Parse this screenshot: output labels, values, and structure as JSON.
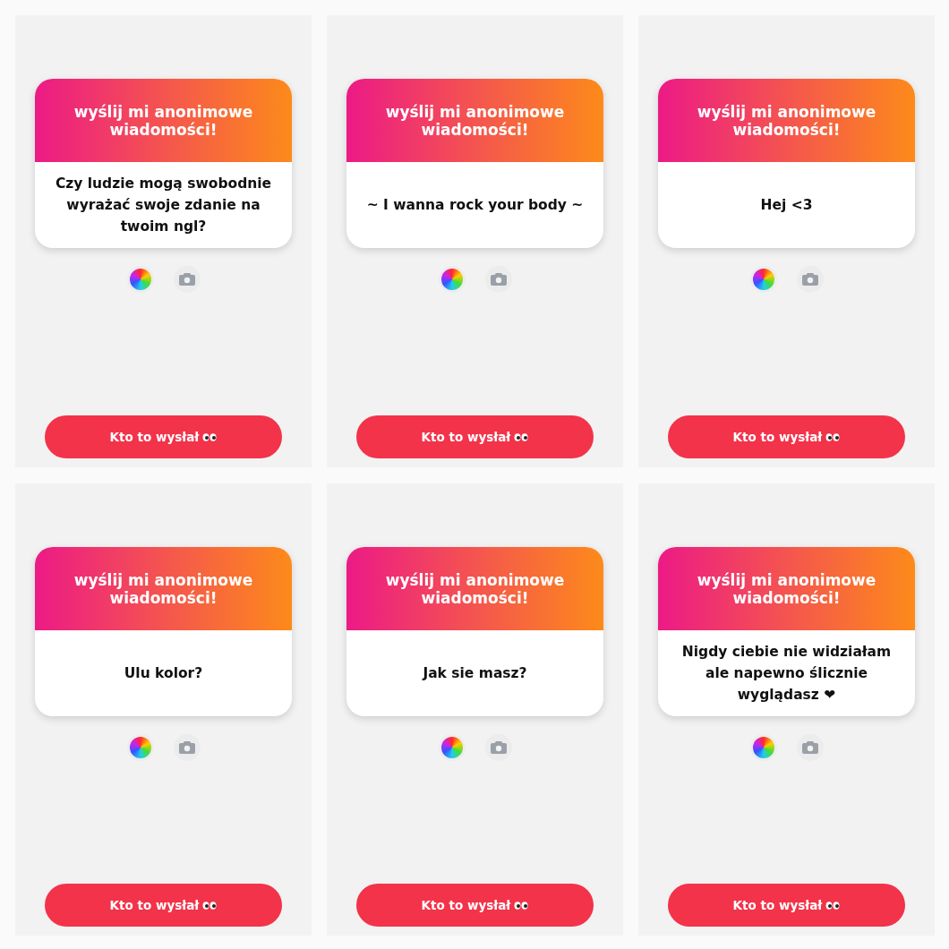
{
  "stories": [
    {
      "header": "wyślij mi anonimowe wiadomości!",
      "message": "Czy ludzie mogą swobodnie wyrażać swoje zdanie na twoim ngl?",
      "button": "Kto to wysłał"
    },
    {
      "header": "wyślij mi anonimowe wiadomości!",
      "message": "~ I wanna rock your body ~",
      "button": "Kto to wysłał"
    },
    {
      "header": "wyślij mi anonimowe wiadomości!",
      "message": "Hej <3",
      "button": "Kto to wysłał"
    },
    {
      "header": "wyślij mi anonimowe wiadomości!",
      "message": "Ulu kolor?",
      "button": "Kto to wysłał"
    },
    {
      "header": "wyślij mi anonimowe wiadomości!",
      "message": "Jak sie masz?",
      "button": "Kto to wysłał"
    },
    {
      "header": "wyślij mi anonimowe wiadomości!",
      "message": "Nigdy ciebie nie widziałam ale napewno ślicznie wyglądasz ❤",
      "button": "Kto to wysłał"
    }
  ]
}
